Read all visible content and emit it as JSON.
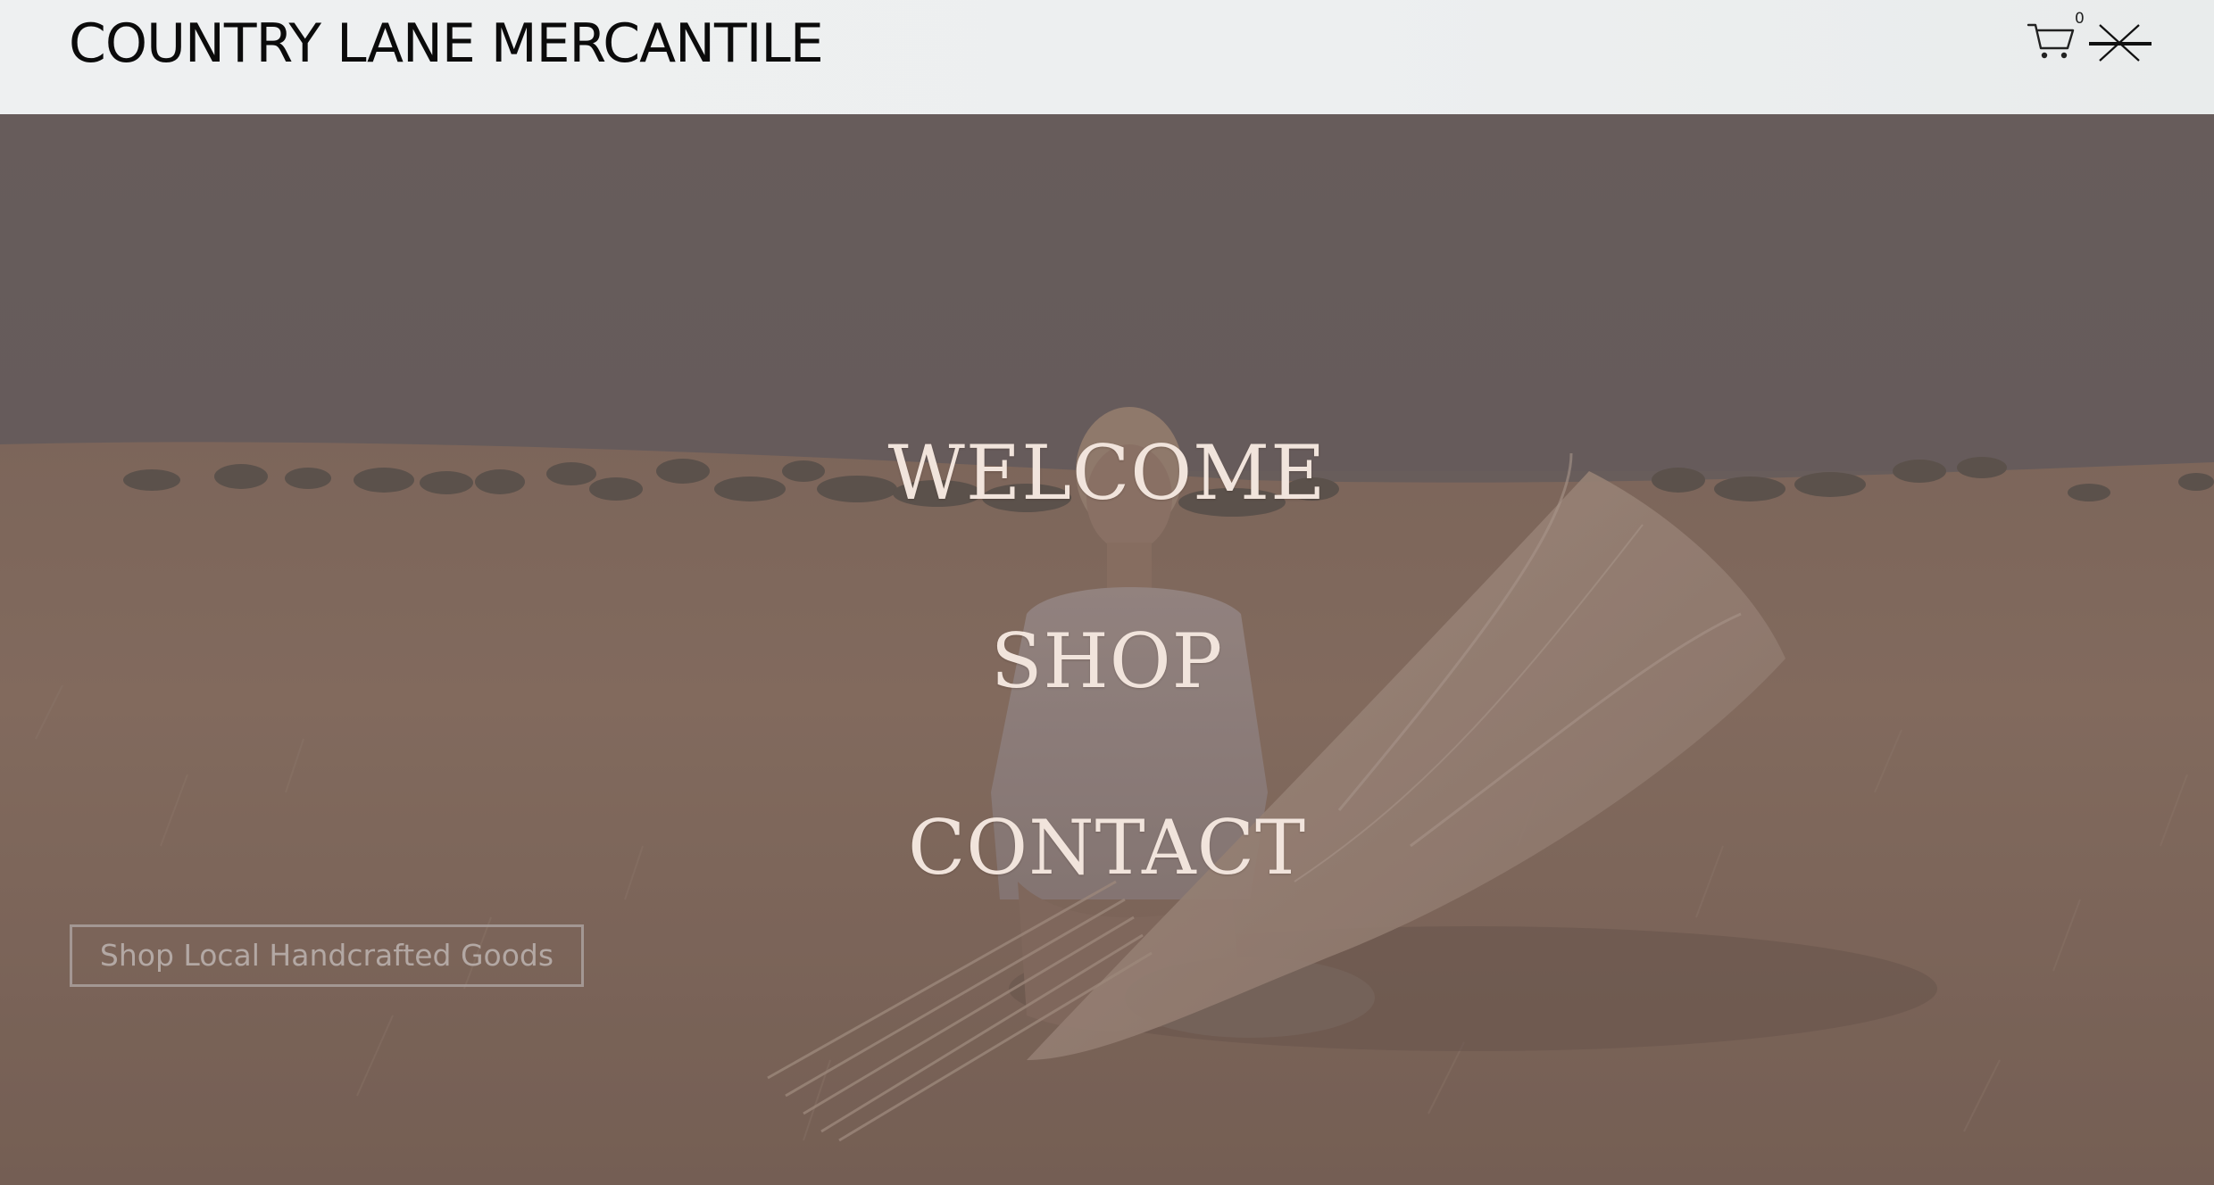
{
  "header": {
    "brand": "COUNTRY LANE MERCANTILE",
    "cart_icon": "cart-icon",
    "cart_count": "0",
    "close_icon": "close-icon"
  },
  "menu": {
    "items": [
      {
        "label": "WELCOME"
      },
      {
        "label": "SHOP"
      },
      {
        "label": "CONTACT"
      }
    ]
  },
  "hero": {
    "cta_label": "Shop Local Handcrafted Goods",
    "image": "woman-with-pampas-grass-in-wheat-field"
  },
  "colors": {
    "header_bg": "#eef0f1",
    "menu_text": "#f1e4dc",
    "overlay": "#6e6461",
    "sky": "#6c6260",
    "field": "#8f7565"
  }
}
